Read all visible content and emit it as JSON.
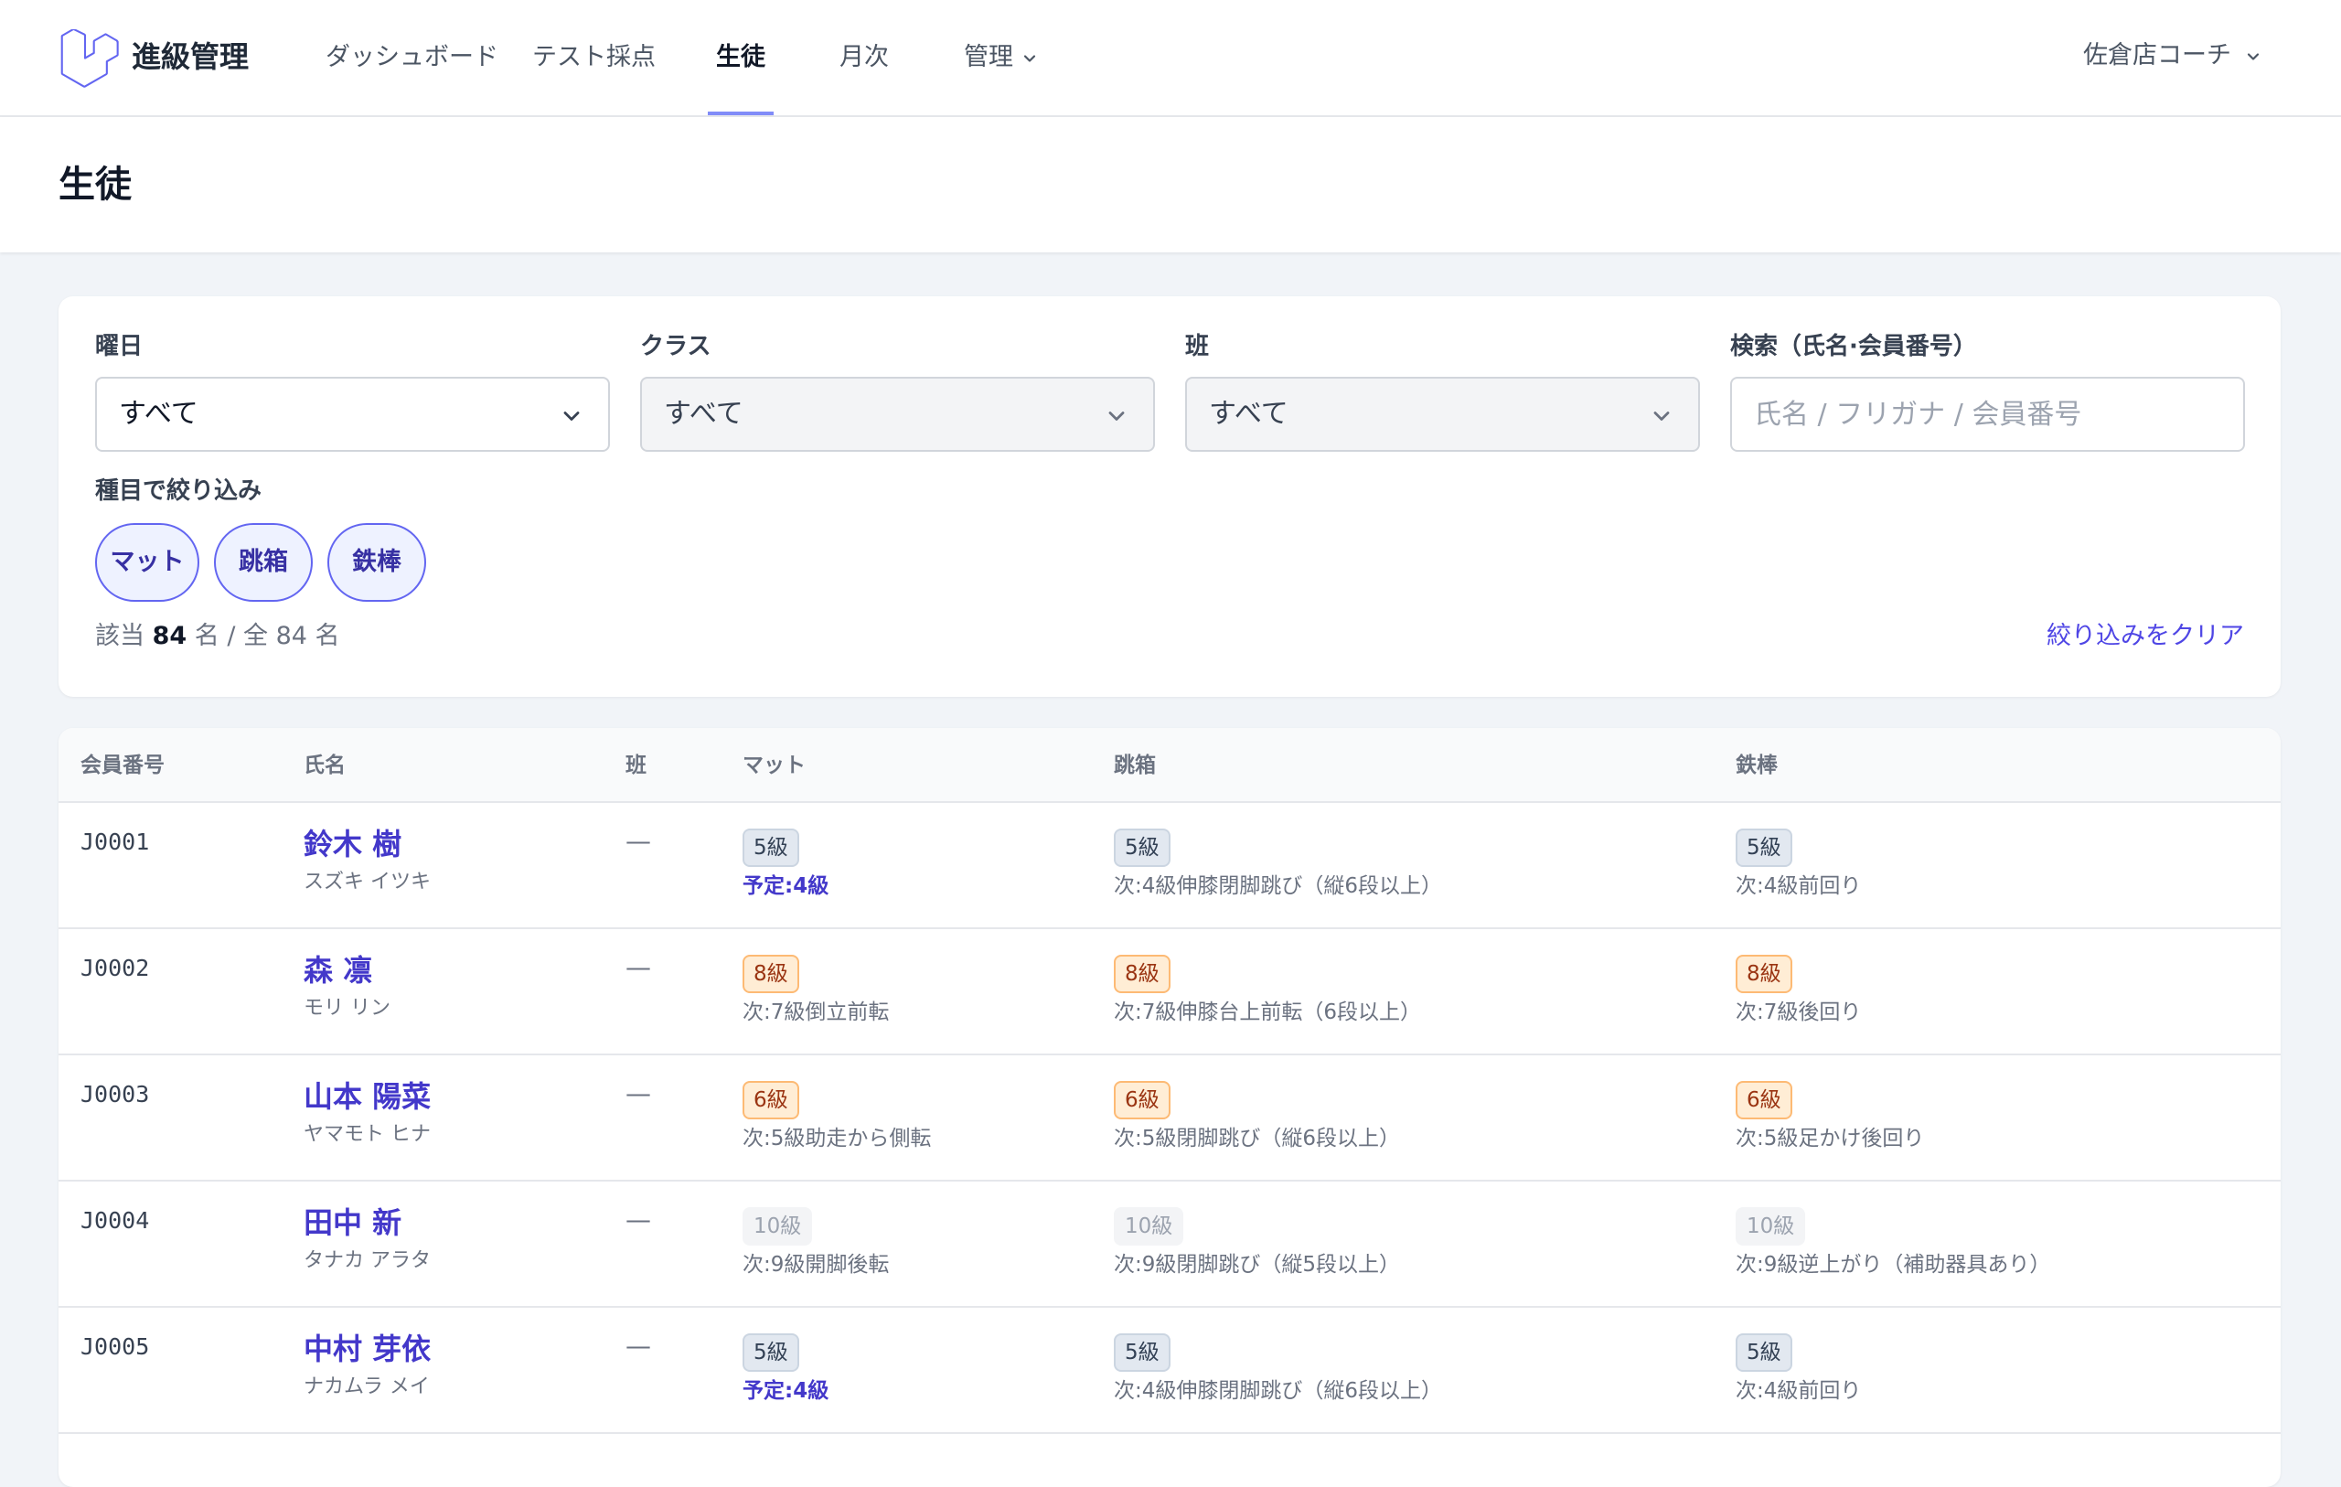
{
  "app": {
    "brand": "進級管理"
  },
  "nav": {
    "items": [
      {
        "label": "ダッシュボード"
      },
      {
        "label": "テスト採点"
      },
      {
        "label": "生徒"
      },
      {
        "label": "月次"
      },
      {
        "label": "管理"
      }
    ],
    "active": "生徒",
    "user": "佐倉店コーチ"
  },
  "page": {
    "title": "生徒"
  },
  "filters": {
    "weekday": {
      "label": "曜日",
      "value": "すべて"
    },
    "class": {
      "label": "クラス",
      "value": "すべて"
    },
    "group": {
      "label": "班",
      "value": "すべて"
    },
    "search": {
      "label": "検索（氏名·会員番号）",
      "placeholder": "氏名 / フリガナ / 会員番号"
    },
    "events_label": "種目で絞り込み",
    "events": [
      {
        "label": "マット"
      },
      {
        "label": "跳箱"
      },
      {
        "label": "鉄棒"
      }
    ],
    "count_prefix": "該当",
    "count_match": "84",
    "count_suffix": "名 / 全 84 名",
    "clear": "絞り込みをクリア"
  },
  "table": {
    "headers": {
      "id": "会員番号",
      "name": "氏名",
      "group": "班",
      "mat": "マット",
      "vault": "跳箱",
      "bar": "鉄棒"
    },
    "rows": [
      {
        "id": "J0001",
        "name": "鈴木 樹",
        "kana": "スズキ イツキ",
        "group": "—",
        "mat": {
          "level": "5級",
          "note": "予定:4級",
          "badge": "slate",
          "note_type": "plan"
        },
        "vault": {
          "level": "5級",
          "note": "次:4級伸膝閉脚跳び（縦6段以上）",
          "badge": "slate",
          "note_type": "next"
        },
        "bar": {
          "level": "5級",
          "note": "次:4級前回り",
          "badge": "slate",
          "note_type": "next"
        }
      },
      {
        "id": "J0002",
        "name": "森 凛",
        "kana": "モリ リン",
        "group": "—",
        "mat": {
          "level": "8級",
          "note": "次:7級倒立前転",
          "badge": "orange",
          "note_type": "next"
        },
        "vault": {
          "level": "8級",
          "note": "次:7級伸膝台上前転（6段以上）",
          "badge": "orange",
          "note_type": "next"
        },
        "bar": {
          "level": "8級",
          "note": "次:7級後回り",
          "badge": "orange",
          "note_type": "next"
        }
      },
      {
        "id": "J0003",
        "name": "山本 陽菜",
        "kana": "ヤマモト ヒナ",
        "group": "—",
        "mat": {
          "level": "6級",
          "note": "次:5級助走から側転",
          "badge": "orange",
          "note_type": "next"
        },
        "vault": {
          "level": "6級",
          "note": "次:5級閉脚跳び（縦6段以上）",
          "badge": "orange",
          "note_type": "next"
        },
        "bar": {
          "level": "6級",
          "note": "次:5級足かけ後回り",
          "badge": "orange",
          "note_type": "next"
        }
      },
      {
        "id": "J0004",
        "name": "田中 新",
        "kana": "タナカ アラタ",
        "group": "—",
        "mat": {
          "level": "10級",
          "note": "次:9級開脚後転",
          "badge": "gray",
          "note_type": "next"
        },
        "vault": {
          "level": "10級",
          "note": "次:9級閉脚跳び（縦5段以上）",
          "badge": "gray",
          "note_type": "next"
        },
        "bar": {
          "level": "10級",
          "note": "次:9級逆上がり（補助器具あり）",
          "badge": "gray",
          "note_type": "next"
        }
      },
      {
        "id": "J0005",
        "name": "中村 芽依",
        "kana": "ナカムラ メイ",
        "group": "—",
        "mat": {
          "level": "5級",
          "note": "予定:4級",
          "badge": "slate",
          "note_type": "plan"
        },
        "vault": {
          "level": "5級",
          "note": "次:4級伸膝閉脚跳び（縦6段以上）",
          "badge": "slate",
          "note_type": "next"
        },
        "bar": {
          "level": "5級",
          "note": "次:4級前回り",
          "badge": "slate",
          "note_type": "next"
        }
      }
    ]
  }
}
